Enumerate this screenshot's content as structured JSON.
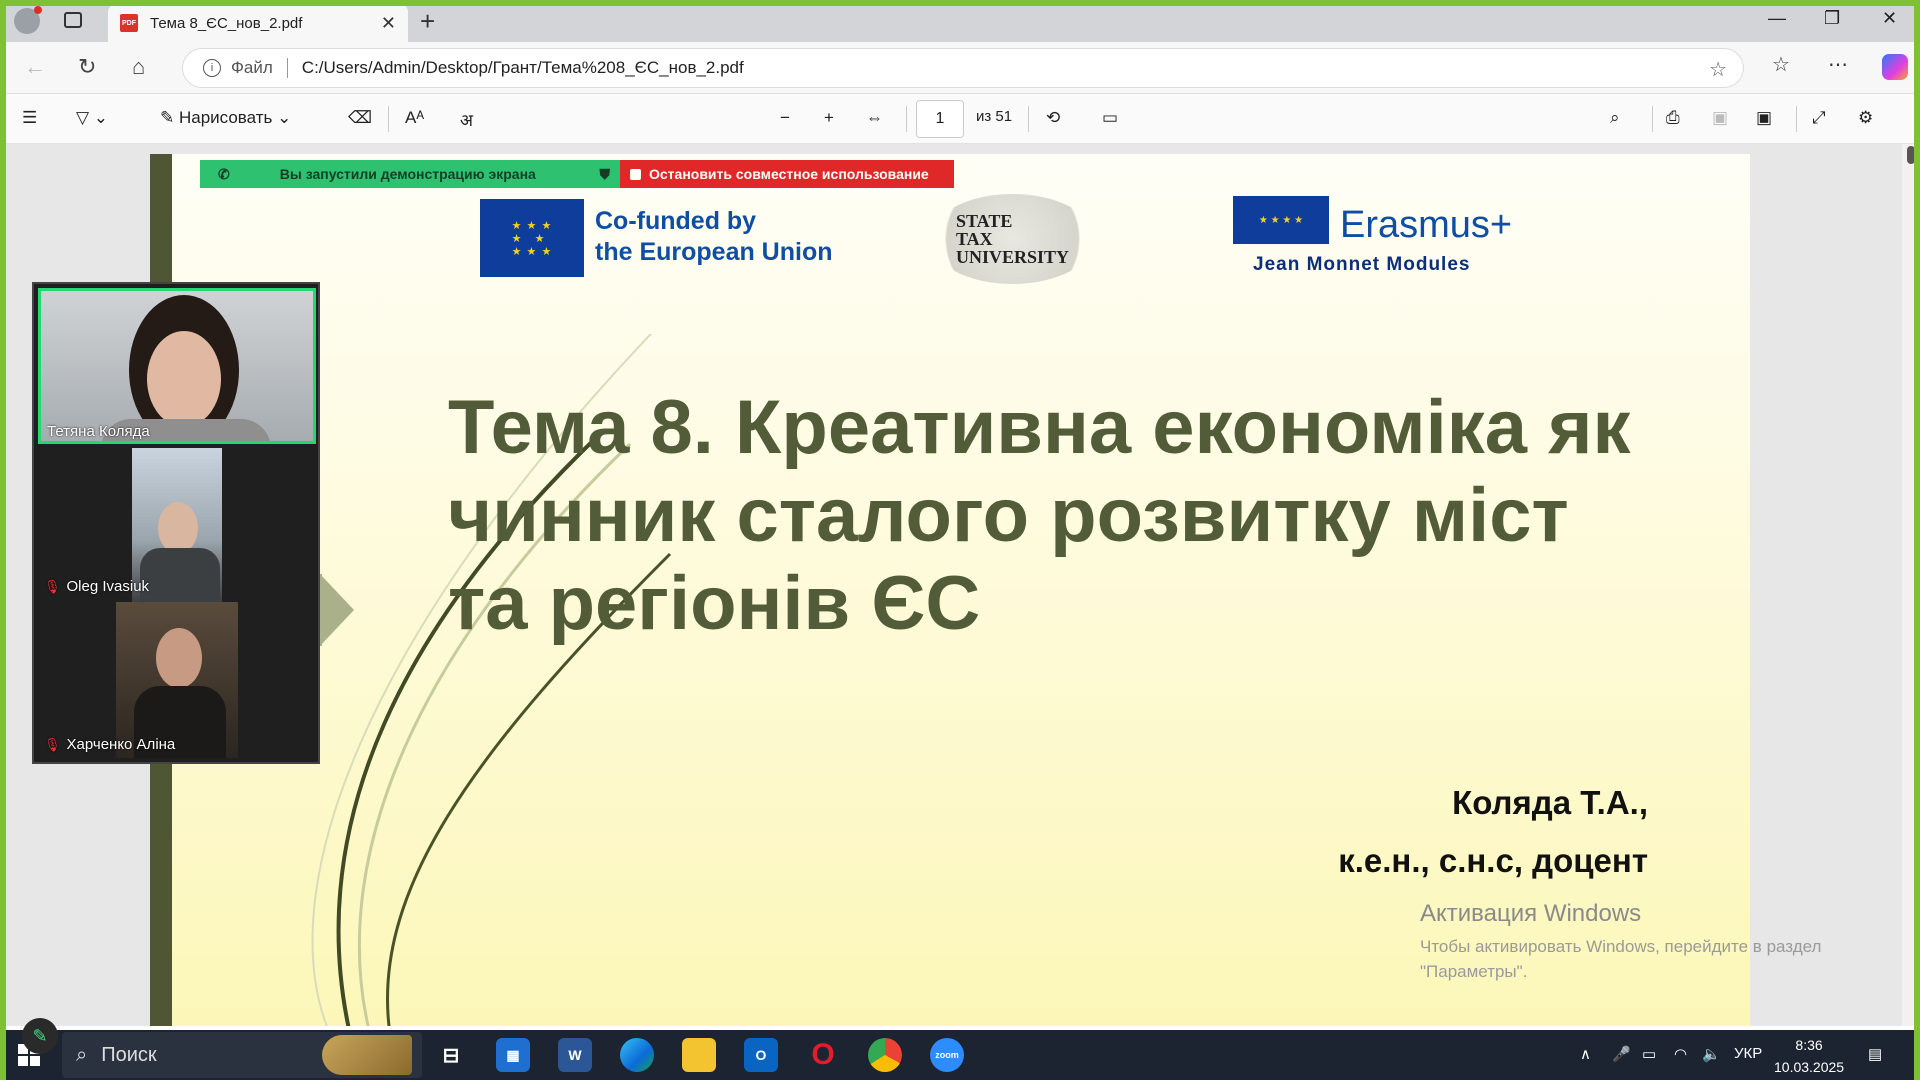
{
  "browser": {
    "tab_title": "Тема 8_ЄС_нов_2.pdf",
    "tab_icon": "PDF",
    "address_label": "Файл",
    "address_url": "C:/Users/Admin/Desktop/Грант/Тема%208_ЄС_нов_2.pdf"
  },
  "pdf_toolbar": {
    "draw_label": "Нарисовать",
    "page_current": "1",
    "page_total": "из 51"
  },
  "share_banner": {
    "sharing_text": "Вы запустили демонстрацию экрана",
    "stop_text": "Остановить совместное использование"
  },
  "slide": {
    "eu_cofunded_line1": "Co-funded by",
    "eu_cofunded_line2": "the European Union",
    "stu_line1": "STATE",
    "stu_line2": "TAX",
    "stu_line3": "UNIVERSITY",
    "erasmus": "Erasmus+",
    "jean_monnet": "Jean Monnet Modules",
    "title_line1": "Тема 8. Креативна економіка як",
    "title_line2": "чинник сталого розвитку міст",
    "title_line3": "та регіонів ЄС",
    "author_name": "Коляда Т.А.,",
    "author_degree": "к.е.н., с.н.с, доцент"
  },
  "activation": {
    "title": "Активация Windows",
    "line1": "Чтобы активировать Windows, перейдите в раздел",
    "line2": "\"Параметры\"."
  },
  "participants": [
    {
      "name": "Тетяна Коляда",
      "muted": false
    },
    {
      "name": "Oleg Ivasiuk",
      "muted": true
    },
    {
      "name": "Харченко Аліна",
      "muted": true
    }
  ],
  "taskbar": {
    "search_label": "Поиск",
    "language": "УКР",
    "time": "8:36",
    "date": "10.03.2025"
  }
}
